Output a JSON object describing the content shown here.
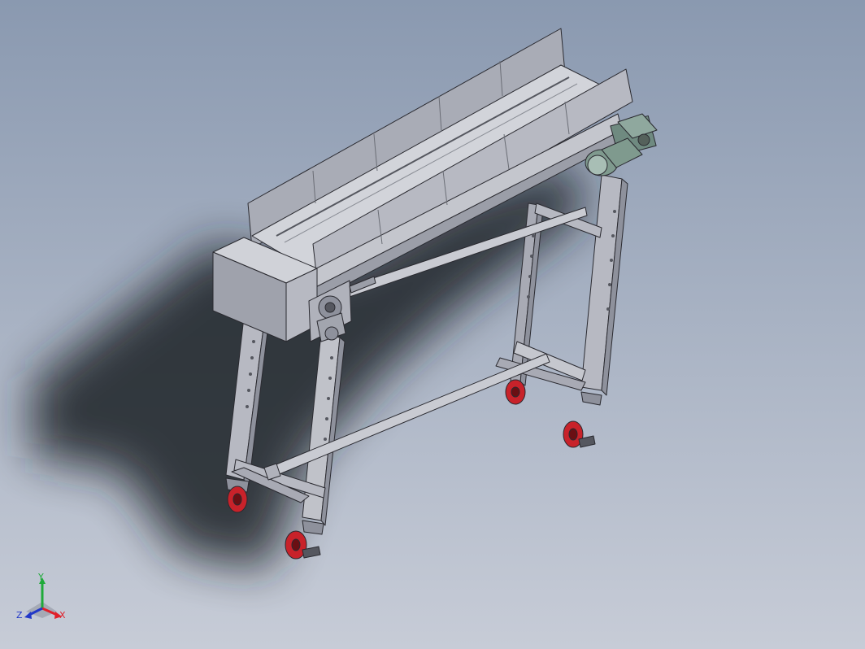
{
  "viewport": {
    "background_top": "#8a99b0",
    "background_bottom": "#c7ccd7",
    "model_fill": "#b7b9c2",
    "model_dark": "#8e919c",
    "model_light": "#d6d8de",
    "edge": "#2a2a30",
    "wheel_red": "#c8222a",
    "motor_green": "#7f9a8e"
  },
  "triad": {
    "x_label": "X",
    "y_label": "Y",
    "z_label": "Z",
    "x_color": "#e0202a",
    "y_color": "#1faa3a",
    "z_color": "#2238c8"
  }
}
